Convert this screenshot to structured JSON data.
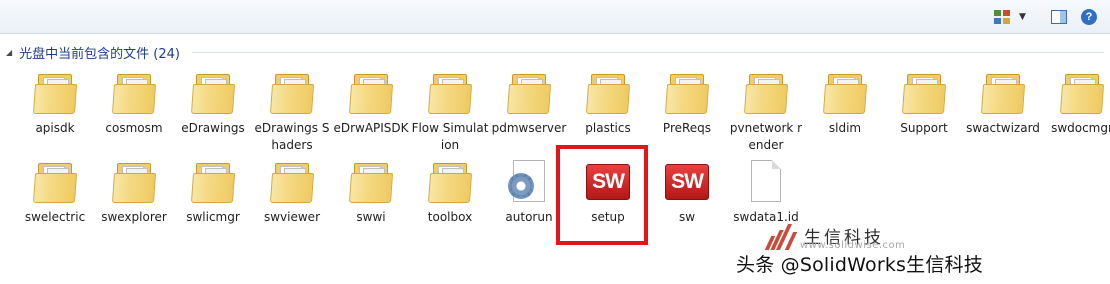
{
  "group": {
    "title": "光盘中当前包含的文件 (24)"
  },
  "items": [
    {
      "label": "apisdk",
      "icon": "folder-icon"
    },
    {
      "label": "cosmosm",
      "icon": "folder-icon"
    },
    {
      "label": "eDrawings",
      "icon": "folder-icon"
    },
    {
      "label": "eDrawings Shaders",
      "icon": "folder-icon"
    },
    {
      "label": "eDrwAPISDK",
      "icon": "folder-icon"
    },
    {
      "label": "Flow Simulation",
      "icon": "folder-icon"
    },
    {
      "label": "pdmwserver",
      "icon": "folder-icon"
    },
    {
      "label": "plastics",
      "icon": "folder-icon"
    },
    {
      "label": "PreReqs",
      "icon": "folder-icon"
    },
    {
      "label": "pvnetwork render",
      "icon": "folder-icon"
    },
    {
      "label": "sldim",
      "icon": "folder-icon"
    },
    {
      "label": "Support",
      "icon": "folder-icon"
    },
    {
      "label": "swactwizard",
      "icon": "folder-icon"
    },
    {
      "label": "swdocmgr",
      "icon": "folder-icon"
    },
    {
      "label": "swelectric",
      "icon": "folder-icon"
    },
    {
      "label": "swexplorer",
      "icon": "folder-icon"
    },
    {
      "label": "swlicmgr",
      "icon": "folder-icon"
    },
    {
      "label": "swviewer",
      "icon": "folder-icon"
    },
    {
      "label": "swwi",
      "icon": "folder-icon"
    },
    {
      "label": "toolbox",
      "icon": "folder-icon"
    },
    {
      "label": "autorun",
      "icon": "autorun-settings-icon"
    },
    {
      "label": "setup",
      "icon": "solidworks-icon",
      "logo_text": "SW"
    },
    {
      "label": "sw",
      "icon": "solidworks-icon",
      "logo_text": "SW"
    },
    {
      "label": "swdata1.id",
      "icon": "blank-file-icon"
    }
  ],
  "watermark": {
    "logo_text": "生信科技",
    "url": "www.solidwise.com",
    "caption": "头条 @SolidWorks生信科技"
  },
  "colors": {
    "highlight": "#e01717",
    "solidworks_red": "#d42424",
    "group_title": "#1e3c8a"
  }
}
